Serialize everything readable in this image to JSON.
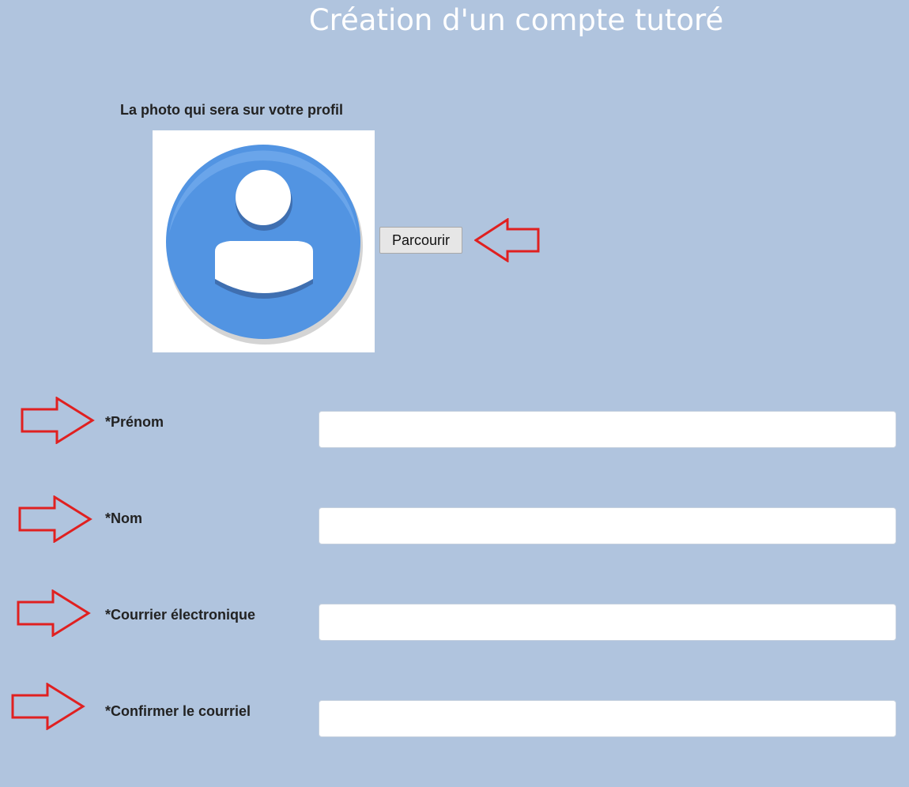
{
  "page": {
    "title": "Création d'un compte tutoré"
  },
  "photo": {
    "label": "La photo qui sera sur votre profil",
    "avatar_icon": "user-avatar-icon",
    "browse_label": "Parcourir"
  },
  "form": {
    "fields": [
      {
        "label": "*Prénom",
        "value": "",
        "placeholder": ""
      },
      {
        "label": "*Nom",
        "value": "",
        "placeholder": ""
      },
      {
        "label": "*Courrier électronique",
        "value": "",
        "placeholder": ""
      },
      {
        "label": "*Confirmer le courriel",
        "value": "",
        "placeholder": ""
      }
    ]
  },
  "annotations": {
    "arrow_icon": "red-outline-arrow-icon",
    "arrow_color": "#e02020"
  },
  "colors": {
    "background": "#b0c4de",
    "title": "#ffffff",
    "avatar_blue": "#5294e2",
    "input_background": "#ffffff"
  }
}
